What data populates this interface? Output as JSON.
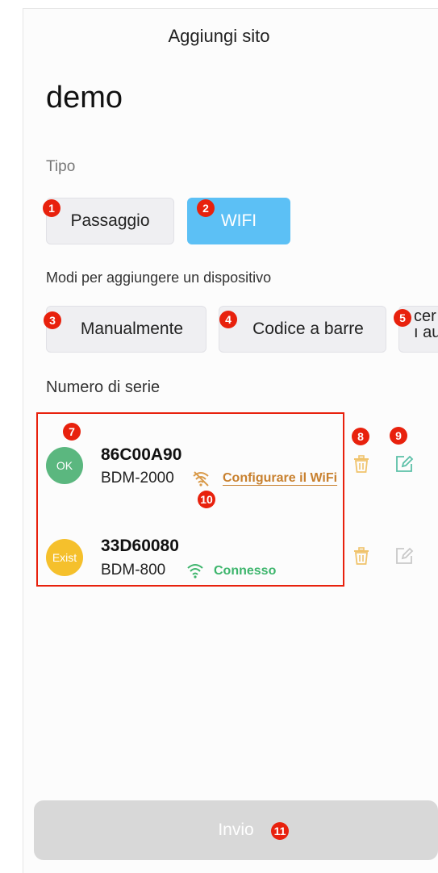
{
  "header": {
    "title": "Aggiungi sito"
  },
  "site": {
    "name": "demo"
  },
  "type_section": {
    "label": "Tipo",
    "options": [
      {
        "label": "Passaggio",
        "badge": "1",
        "selected": false
      },
      {
        "label": "WIFI",
        "badge": "2",
        "selected": true
      }
    ]
  },
  "add_methods": {
    "label": "Modi per aggiungere un dispositivo",
    "options": [
      {
        "label": "Manualmente",
        "badge": "3"
      },
      {
        "label": "Codice a barre",
        "badge": "4"
      },
      {
        "label_line1": "cer",
        "label_line2": "ı au",
        "badge": "5"
      }
    ]
  },
  "serial_section": {
    "label": "Numero di serie"
  },
  "devices": [
    {
      "avatar_text": "OK",
      "avatar_color": "#5bb77f",
      "serial": "86C00A90",
      "model": "BDM-2000",
      "status": "Configurare il WiFi",
      "status_color": "#c8802e",
      "wifi": "disconnected",
      "badge_avatar": "7",
      "badge_wifi": "10"
    },
    {
      "avatar_text": "Exist",
      "avatar_color": "#f5c02c",
      "serial": "33D60080",
      "model": "BDM-800",
      "status": "Connesso",
      "status_color": "#3db56c",
      "wifi": "connected"
    }
  ],
  "actions": {
    "delete_badge": "8",
    "edit_badge": "9"
  },
  "footer": {
    "submit_label": "Invio",
    "submit_badge": "11"
  },
  "colors": {
    "accent": "#5cc0f5",
    "badge": "#e8210d",
    "delete": "#f0c36b",
    "edit": "#5cc0a8"
  }
}
